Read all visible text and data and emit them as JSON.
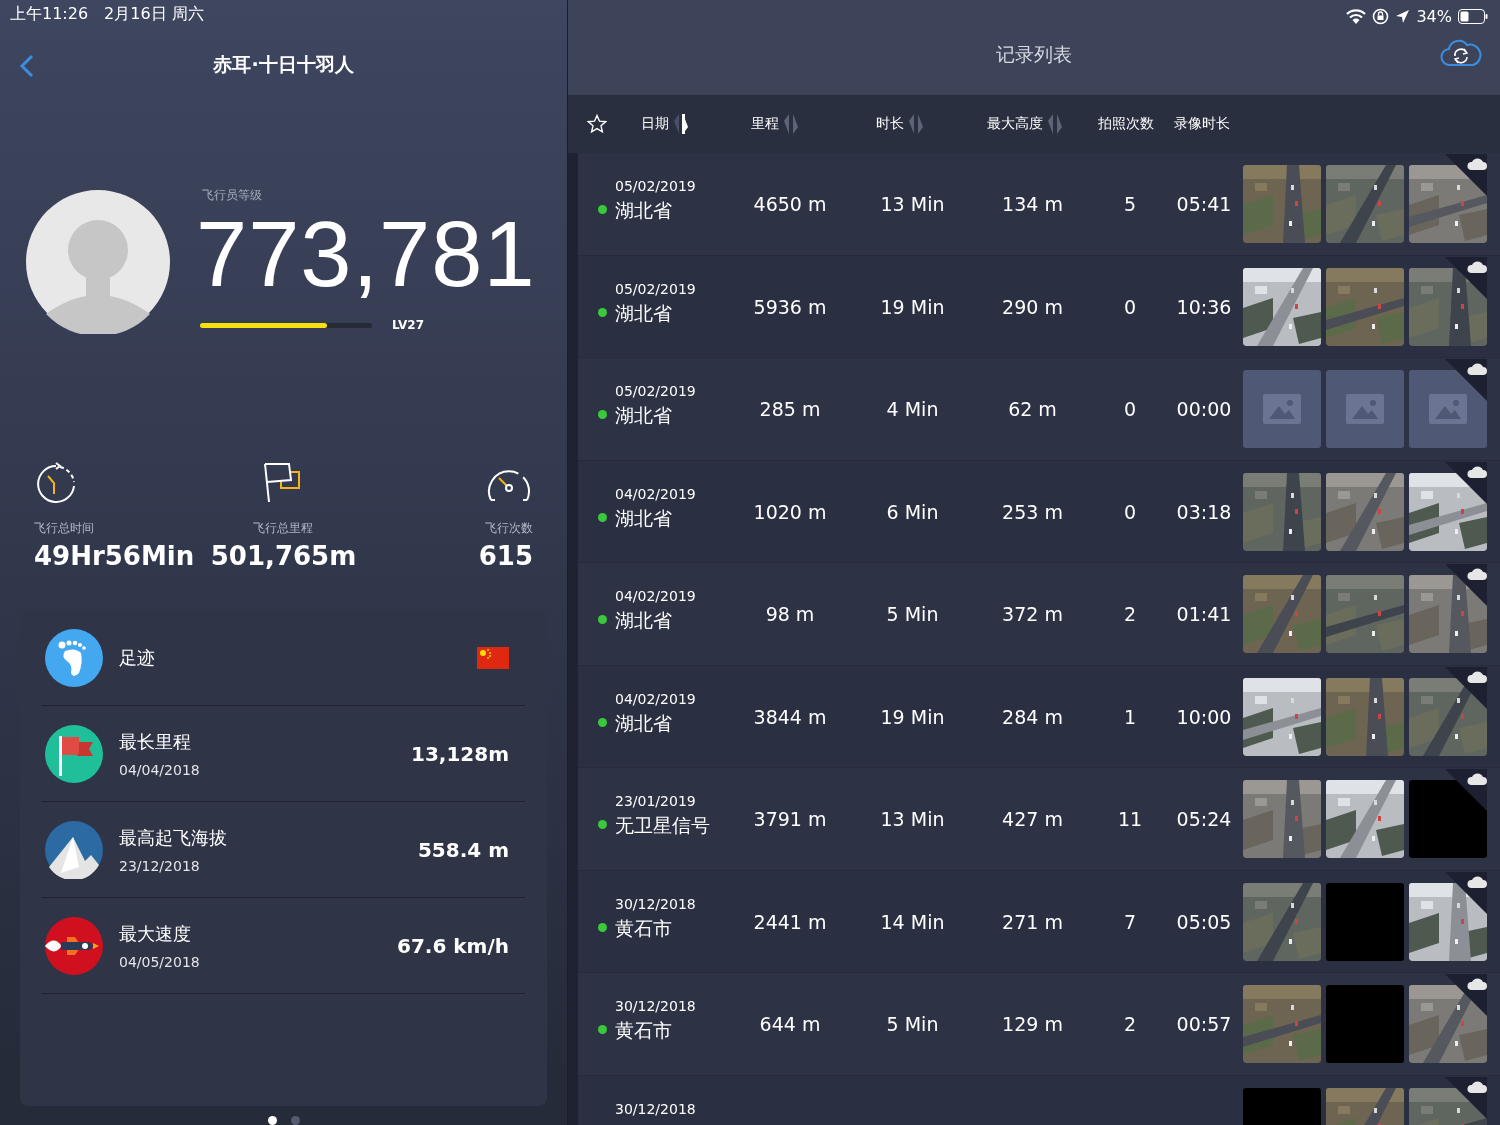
{
  "status_bar": {
    "time": "上午11:26",
    "date": "2月16日 周六",
    "battery": "34%"
  },
  "profile": {
    "title": "赤耳·十日十羽人",
    "rank_label": "飞行员等级",
    "score": "773,781",
    "level": 0.74,
    "level_label": "LV27"
  },
  "stats": [
    {
      "kind": "time",
      "label": "飞行总时间",
      "value": "49Hr56Min"
    },
    {
      "kind": "distance",
      "label": "飞行总里程",
      "value": "501,765m"
    },
    {
      "kind": "count",
      "label": "飞行次数",
      "value": "615"
    }
  ],
  "records": [
    {
      "kind": "footprint",
      "title": "足迹"
    },
    {
      "kind": "distance",
      "title": "最长里程",
      "date": "04/04/2018",
      "value": "13,128m"
    },
    {
      "kind": "altitude",
      "title": "最高起飞海拔",
      "date": "23/12/2018",
      "value": "558.4 m"
    },
    {
      "kind": "speed",
      "title": "最大速度",
      "date": "04/05/2018",
      "value": "67.6 km/h"
    }
  ],
  "pager": [
    {
      "selected": true
    },
    {
      "selected": false
    }
  ],
  "list": {
    "title": "记录列表",
    "columns": [
      {
        "label": "日期",
        "kind": "sortable",
        "active": true
      },
      {
        "label": "里程",
        "kind": "sortable",
        "active": false
      },
      {
        "label": "时长",
        "kind": "sortable",
        "active": false
      },
      {
        "label": "最大高度",
        "kind": "sortable",
        "active": false
      },
      {
        "label": "拍照次数",
        "kind": "plain"
      },
      {
        "label": "录像时长",
        "kind": "plain"
      }
    ],
    "rows": [
      {
        "date": "05/02/2019",
        "place": "湖北省",
        "distance": "4650 m",
        "duration": "13 Min",
        "max_height": "134 m",
        "photos": "5",
        "video": "05:41",
        "thumbnails": [
          {
            "kind": "picture"
          },
          {
            "kind": "picture"
          },
          {
            "kind": "picture"
          }
        ]
      },
      {
        "date": "05/02/2019",
        "place": "湖北省",
        "distance": "5936 m",
        "duration": "19 Min",
        "max_height": "290 m",
        "photos": "0",
        "video": "10:36",
        "thumbnails": [
          {
            "kind": "picture"
          },
          {
            "kind": "picture"
          },
          {
            "kind": "picture"
          }
        ]
      },
      {
        "date": "05/02/2019",
        "place": "湖北省",
        "distance": "285 m",
        "duration": "4 Min",
        "max_height": "62 m",
        "photos": "0",
        "video": "00:00",
        "thumbnails": [
          {
            "kind": "placeholder"
          },
          {
            "kind": "placeholder"
          },
          {
            "kind": "placeholder"
          }
        ]
      },
      {
        "date": "04/02/2019",
        "place": "湖北省",
        "distance": "1020 m",
        "duration": "6 Min",
        "max_height": "253 m",
        "photos": "0",
        "video": "03:18",
        "thumbnails": [
          {
            "kind": "picture"
          },
          {
            "kind": "picture"
          },
          {
            "kind": "picture"
          }
        ]
      },
      {
        "date": "04/02/2019",
        "place": "湖北省",
        "distance": "98 m",
        "duration": "5 Min",
        "max_height": "372 m",
        "photos": "2",
        "video": "01:41",
        "thumbnails": [
          {
            "kind": "picture"
          },
          {
            "kind": "picture"
          },
          {
            "kind": "picture"
          }
        ]
      },
      {
        "date": "04/02/2019",
        "place": "湖北省",
        "distance": "3844 m",
        "duration": "19 Min",
        "max_height": "284 m",
        "photos": "1",
        "video": "10:00",
        "thumbnails": [
          {
            "kind": "picture"
          },
          {
            "kind": "picture"
          },
          {
            "kind": "picture"
          }
        ]
      },
      {
        "date": "23/01/2019",
        "place": "无卫星信号",
        "distance": "3791 m",
        "duration": "13 Min",
        "max_height": "427 m",
        "photos": "11",
        "video": "05:24",
        "thumbnails": [
          {
            "kind": "picture"
          },
          {
            "kind": "picture"
          },
          {
            "kind": "empty"
          }
        ]
      },
      {
        "date": "30/12/2018",
        "place": "黄石市",
        "distance": "2441 m",
        "duration": "14 Min",
        "max_height": "271 m",
        "photos": "7",
        "video": "05:05",
        "thumbnails": [
          {
            "kind": "picture"
          },
          {
            "kind": "empty"
          },
          {
            "kind": "picture"
          }
        ]
      },
      {
        "date": "30/12/2018",
        "place": "黄石市",
        "distance": "644 m",
        "duration": "5 Min",
        "max_height": "129 m",
        "photos": "2",
        "video": "00:57",
        "thumbnails": [
          {
            "kind": "picture"
          },
          {
            "kind": "empty"
          },
          {
            "kind": "picture"
          }
        ]
      },
      {
        "date": "30/12/2018",
        "thumbnails": [
          {
            "kind": "empty"
          },
          {
            "kind": "picture"
          },
          {
            "kind": "picture"
          }
        ]
      }
    ]
  }
}
